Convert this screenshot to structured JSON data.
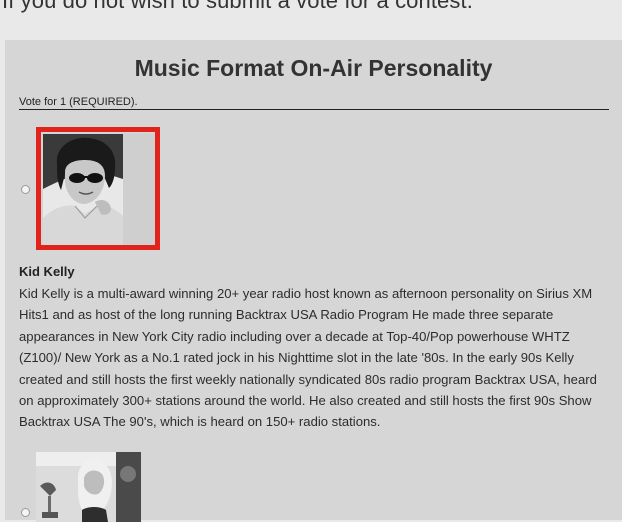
{
  "page": {
    "instruction_text": "If you do not wish to submit a vote for a contest."
  },
  "contest": {
    "title": "Music Format On-Air Personality",
    "vote_instruction": "Vote for 1 (REQUIRED).",
    "candidates": [
      {
        "name": "Kid Kelly",
        "selected": false,
        "highlighted": true,
        "bio": "Kid Kelly is a multi-award winning 20+ year radio host known as afternoon personality on Sirius XM Hits1 and as host of the long running Backtrax USA Radio Program He made three separate appearances in New York City radio including over a decade at Top-40/Pop powerhouse WHTZ (Z100)/ New York as a No.1 rated jock in his Nighttime slot in the late '80s. In the early 90s Kelly created and still hosts the first weekly nationally syndicated 80s radio program Backtrax USA, heard on approximately 300+ stations around the world. He also created and still hosts the first 90s Show Backtrax USA The 90's, which is heard on 150+ radio stations."
      },
      {
        "selected": false
      }
    ]
  },
  "colors": {
    "page_background": "#e9e9e9",
    "panel_background": "#d6d6d6",
    "highlight_border": "#e0231b",
    "text": "#222222"
  }
}
